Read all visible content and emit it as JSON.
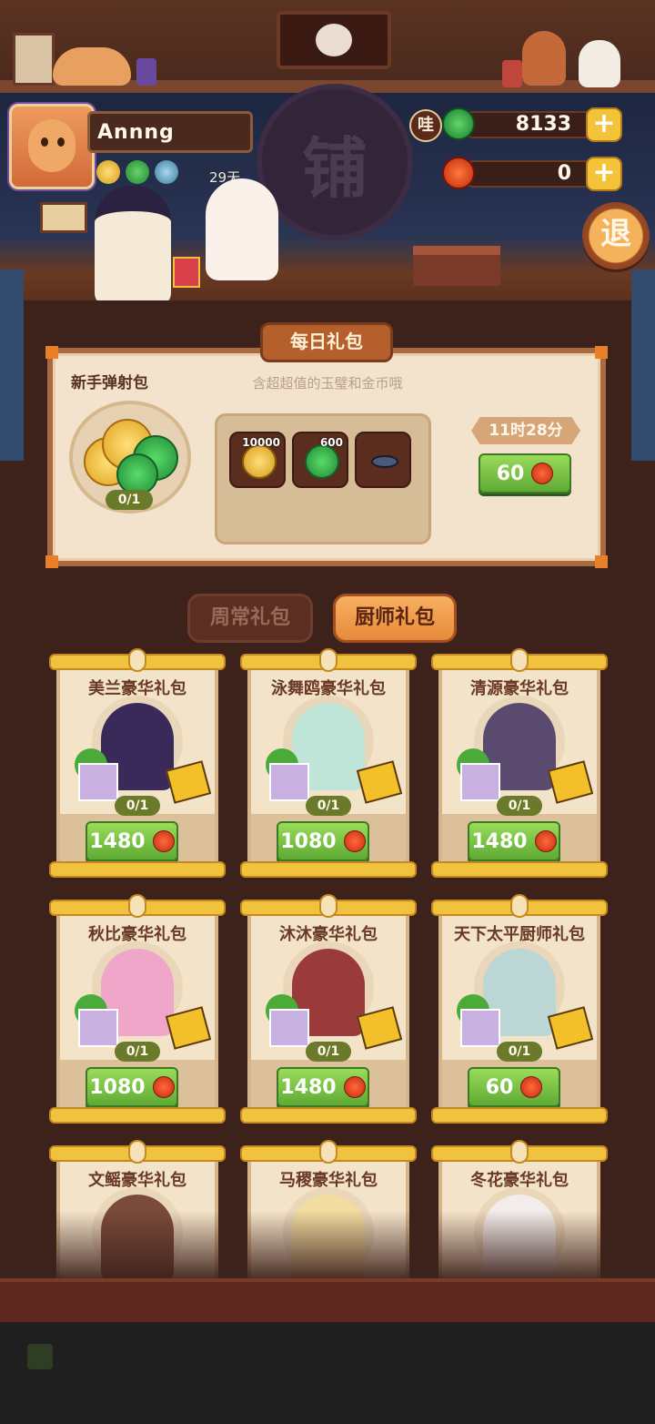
{
  "player": {
    "name": "Annng",
    "days": "29天"
  },
  "currency": {
    "badge": "哇",
    "jade": "8133",
    "apple": "0",
    "plus": "+"
  },
  "exit_label": "退",
  "shop_sign": "铺",
  "daily": {
    "banner": "每日礼包",
    "title": "新手弹射包",
    "description": "含超超值的玉璧和金币哦",
    "progress": "0/1",
    "rewards": [
      {
        "icon": "gold-coin-icon",
        "amount": "10000"
      },
      {
        "icon": "jade-disc-icon",
        "amount": "600"
      },
      {
        "icon": "inkstone-icon",
        "amount": ""
      }
    ],
    "timer": "11时28分",
    "price": "60"
  },
  "tabs": [
    {
      "label": "周常礼包",
      "active": false
    },
    {
      "label": "厨师礼包",
      "active": true
    }
  ],
  "packs": [
    {
      "title": "美兰豪华礼包",
      "progress": "0/1",
      "price": "1480",
      "color": "#3a2a5a"
    },
    {
      "title": "泳舞鸥豪华礼包",
      "progress": "0/1",
      "price": "1080",
      "color": "#bfe4d8"
    },
    {
      "title": "清源豪华礼包",
      "progress": "0/1",
      "price": "1480",
      "color": "#5a4a70"
    },
    {
      "title": "秋比豪华礼包",
      "progress": "0/1",
      "price": "1080",
      "color": "#f0a6c8"
    },
    {
      "title": "沐沐豪华礼包",
      "progress": "0/1",
      "price": "1480",
      "color": "#9a3a3a"
    },
    {
      "title": "天下太平厨师礼包",
      "progress": "0/1",
      "price": "60",
      "color": "#bcd6d6"
    },
    {
      "title": "文鳐豪华礼包",
      "progress": "",
      "price": "",
      "color": "#7a4a3a"
    },
    {
      "title": "马稷豪华礼包",
      "progress": "",
      "price": "",
      "color": "#f2dca0"
    },
    {
      "title": "冬花豪华礼包",
      "progress": "",
      "price": "",
      "color": "#f2ecea"
    }
  ]
}
